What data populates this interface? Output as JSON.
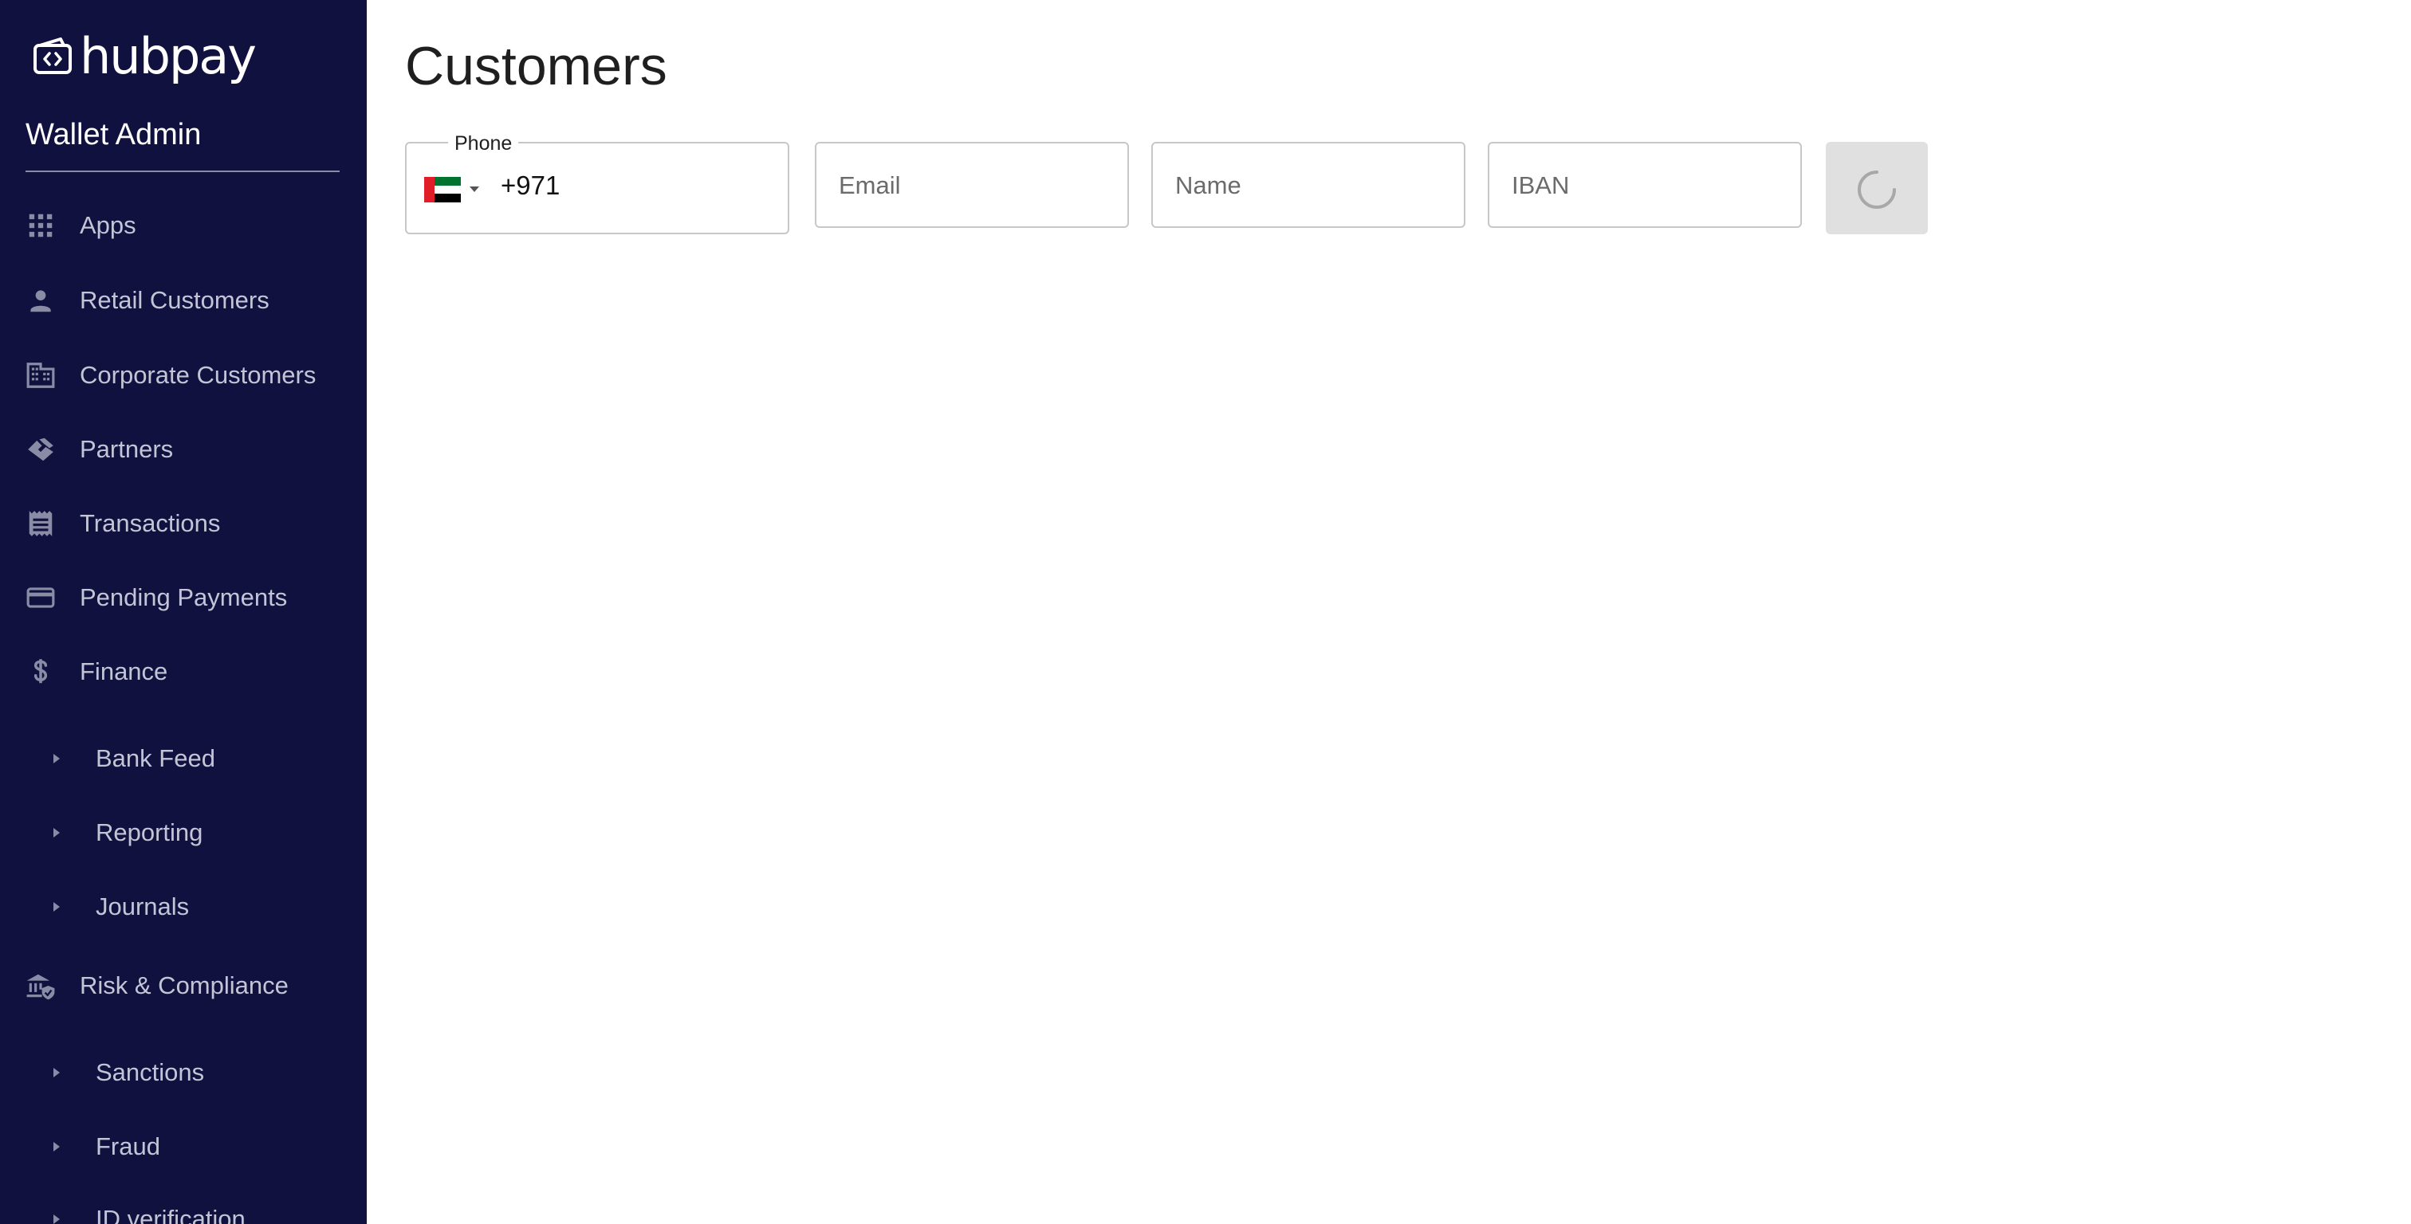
{
  "brand": {
    "name": "hubpay",
    "app_title": "Wallet Admin"
  },
  "sidebar": {
    "items": [
      {
        "label": "Apps",
        "icon": "apps-grid-icon"
      },
      {
        "label": "Retail Customers",
        "icon": "person-icon"
      },
      {
        "label": "Corporate Customers",
        "icon": "building-icon"
      },
      {
        "label": "Partners",
        "icon": "handshake-icon"
      },
      {
        "label": "Transactions",
        "icon": "receipt-icon"
      },
      {
        "label": "Pending Payments",
        "icon": "credit-card-icon"
      },
      {
        "label": "Finance",
        "icon": "dollar-icon"
      },
      {
        "label": "Bank Feed",
        "icon": "caret-right-icon"
      },
      {
        "label": "Reporting",
        "icon": "caret-right-icon"
      },
      {
        "label": "Journals",
        "icon": "caret-right-icon"
      },
      {
        "label": "Risk & Compliance",
        "icon": "bank-shield-icon"
      },
      {
        "label": "Sanctions",
        "icon": "caret-right-icon"
      },
      {
        "label": "Fraud",
        "icon": "caret-right-icon"
      },
      {
        "label": "ID verification",
        "icon": "caret-right-icon"
      }
    ]
  },
  "main": {
    "title": "Customers",
    "filters": {
      "phone": {
        "label": "Phone",
        "country_flag": "uae-flag-icon",
        "value": "+971"
      },
      "email": {
        "placeholder": "Email"
      },
      "name": {
        "placeholder": "Name"
      },
      "iban": {
        "placeholder": "IBAN"
      }
    },
    "search_button": {
      "state": "loading",
      "icon": "spinner-icon"
    }
  },
  "colors": {
    "sidebar_bg": "#11113f",
    "sidebar_text": "#c3c5d6",
    "button_bg": "#e0e0e0"
  }
}
